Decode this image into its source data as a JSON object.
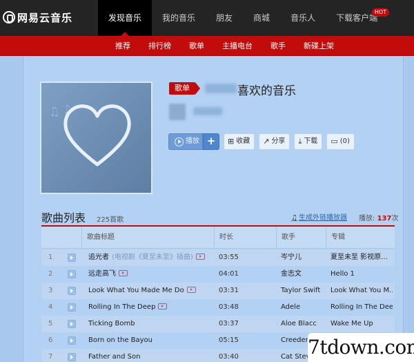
{
  "brand": {
    "logo_text": "网易云音乐"
  },
  "nav": {
    "items": [
      {
        "label": "发现音乐",
        "active": true
      },
      {
        "label": "我的音乐"
      },
      {
        "label": "朋友"
      },
      {
        "label": "商城"
      },
      {
        "label": "音乐人"
      },
      {
        "label": "下载客户端",
        "badge": "HOT"
      }
    ]
  },
  "subnav": {
    "items": [
      "推荐",
      "排行榜",
      "歌单",
      "主播电台",
      "歌手",
      "新碟上架"
    ]
  },
  "playlist": {
    "type_badge": "歌单",
    "title": "喜欢的音乐",
    "buttons": {
      "play": "播放",
      "add": "+",
      "collect": "收藏",
      "share": "分享",
      "download": "下载",
      "comment": "(0)"
    }
  },
  "songlist": {
    "heading": "歌曲列表",
    "count": "225首歌",
    "generate_link": "生成外链播放器",
    "play_label": "播放:",
    "play_count": "137",
    "play_unit": "次",
    "columns": [
      "",
      "歌曲标题",
      "时长",
      "歌手",
      "专辑"
    ],
    "rows": [
      {
        "idx": "1",
        "title": "追光者",
        "subtitle": "(电视剧《夏至未至》插曲)",
        "mv": true,
        "duration": "03:55",
        "artist": "岑宁儿",
        "album": "夏至未至 影视原..."
      },
      {
        "idx": "2",
        "title": "远走高飞",
        "subtitle": "",
        "mv": true,
        "duration": "04:01",
        "artist": "金志文",
        "album": "Hello 1"
      },
      {
        "idx": "3",
        "title": "Look What You Made Me Do",
        "subtitle": "",
        "mv": true,
        "duration": "03:31",
        "artist": "Taylor Swift",
        "album": "Look What You M..."
      },
      {
        "idx": "4",
        "title": "Rolling In The Deep",
        "subtitle": "",
        "mv": true,
        "duration": "03:48",
        "artist": "Adele",
        "album": "Rolling In The Deep"
      },
      {
        "idx": "5",
        "title": "Ticking Bomb",
        "subtitle": "",
        "mv": false,
        "duration": "03:37",
        "artist": "Aloe Blacc",
        "album": "Wake Me Up"
      },
      {
        "idx": "6",
        "title": "Born on the Bayou",
        "subtitle": "",
        "mv": false,
        "duration": "05:15",
        "artist": "Creedence",
        "album": ""
      },
      {
        "idx": "7",
        "title": "Father and Son",
        "subtitle": "",
        "mv": false,
        "duration": "03:40",
        "artist": "Cat Stevens",
        "album": ""
      }
    ]
  },
  "watermark": "7tdown.com",
  "colors": {
    "brand_red": "#c20c0c",
    "topbar": "#242424",
    "link_blue": "#2a66b6"
  }
}
